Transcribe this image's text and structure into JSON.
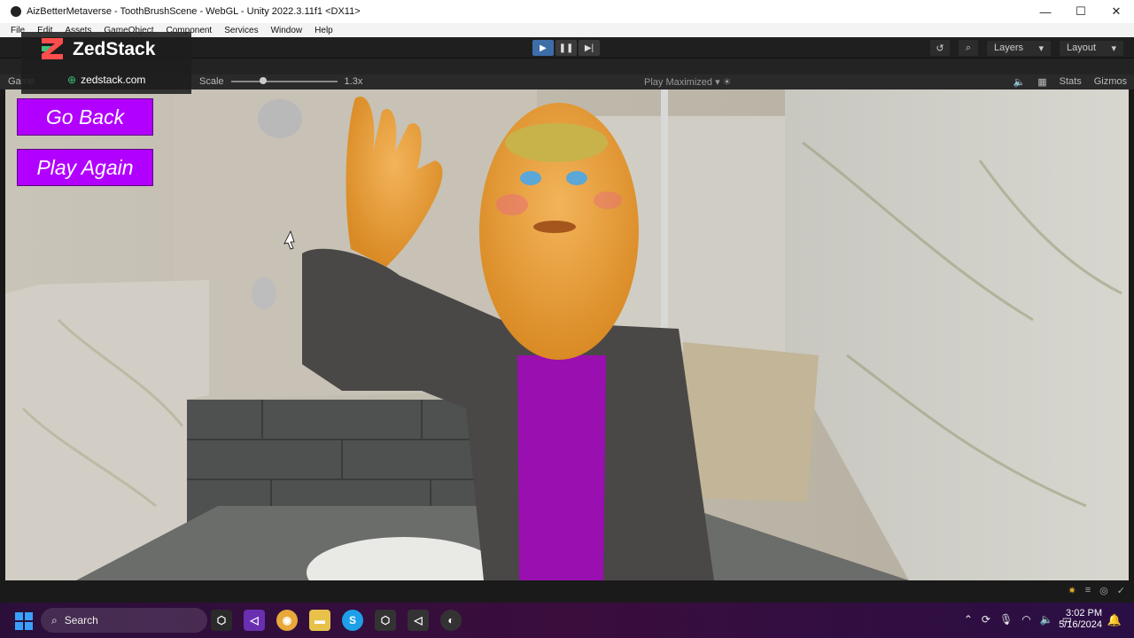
{
  "window": {
    "title": "AizBetterMetaverse - ToothBrushScene - WebGL - Unity 2022.3.11f1 <DX11>"
  },
  "menubar": {
    "items": [
      "File",
      "Edit",
      "Assets",
      "GameObject",
      "Component",
      "Services",
      "Window",
      "Help"
    ]
  },
  "toolbar": {
    "layers_label": "Layers",
    "layout_label": "Layout"
  },
  "watermark": {
    "brand": "ZedStack",
    "url": "zedstack.com"
  },
  "game_view": {
    "tab_label": "Game",
    "scale_label": "Scale",
    "scale_value": "1.3x",
    "play_mode_label": "Play Maximized",
    "stats_label": "Stats",
    "gizmos_label": "Gizmos"
  },
  "scene": {
    "go_back_label": "Go Back",
    "play_again_label": "Play Again",
    "button_color": "#b100ff",
    "shirt_color": "#9a0fb0"
  },
  "taskbar": {
    "search_label": "Search",
    "time": "3:02 PM",
    "date": "5/16/2024"
  }
}
